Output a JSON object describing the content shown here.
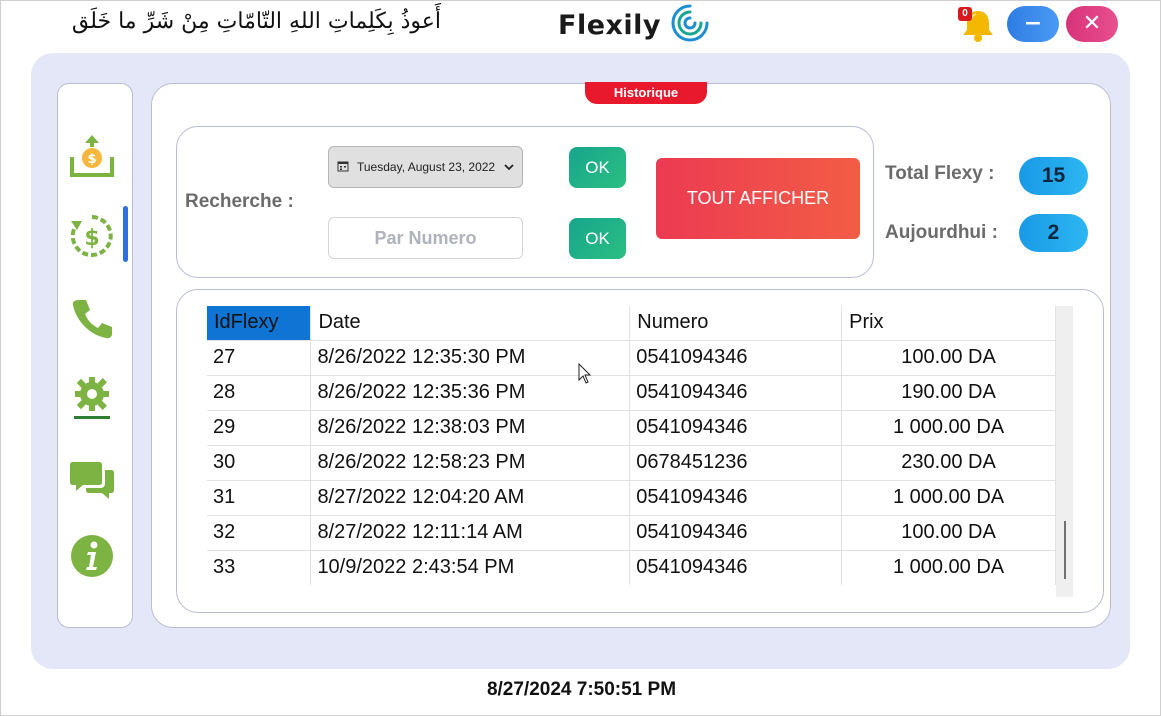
{
  "header": {
    "arabic_text": "أَعوذُ بِكَلِماتِ اللهِ التّامّاتِ مِنْ شَرِّ ما خَلَق",
    "brand_name": "Flexily",
    "brand_icon": "spiral-logo",
    "notification_count": "0",
    "minimize_label": "−",
    "close_label": "✕"
  },
  "sidebar": {
    "items": [
      {
        "name": "upload-money-icon"
      },
      {
        "name": "history-money-icon"
      },
      {
        "name": "phone-icon"
      },
      {
        "name": "settings-icon"
      },
      {
        "name": "chat-icon"
      },
      {
        "name": "info-icon"
      }
    ],
    "accent_color": "#7cb342",
    "active_index": 1
  },
  "tab": {
    "title": "Historique"
  },
  "search": {
    "label": "Recherche :",
    "date_value": "Tuesday, August 23, 2022",
    "number_placeholder": "Par Numero",
    "ok_label_1": "OK",
    "ok_label_2": "OK",
    "show_all_label": "TOUT AFFICHER"
  },
  "stats": {
    "total_label": "Total Flexy  :",
    "total_value": "15",
    "today_label": "Aujourdhui :",
    "today_value": "2"
  },
  "table": {
    "columns": [
      "IdFlexy",
      "Date",
      "Numero",
      "Prix"
    ],
    "rows": [
      [
        "27",
        "8/26/2022 12:35:30 PM",
        "0541094346",
        "100.00 DA"
      ],
      [
        "28",
        "8/26/2022 12:35:36 PM",
        "0541094346",
        "190.00 DA"
      ],
      [
        "29",
        "8/26/2022 12:38:03 PM",
        "0541094346",
        "1 000.00 DA"
      ],
      [
        "30",
        "8/26/2022 12:58:23 PM",
        "0678451236",
        "230.00 DA"
      ],
      [
        "31",
        "8/27/2022 12:04:20 AM",
        "0541094346",
        "1 000.00 DA"
      ],
      [
        "32",
        "8/27/2022 12:11:14 AM",
        "0541094346",
        "100.00 DA"
      ],
      [
        "33",
        "10/9/2022 2:43:54 PM",
        "0541094346",
        "1 000.00 DA"
      ]
    ]
  },
  "footer": {
    "datetime": "8/27/2024 7:50:51 PM"
  },
  "colors": {
    "tab_red": "#e8192c",
    "ok_green": "#17a58c",
    "show_all": "#ec3a52",
    "pill_blue": "#1a9ae6",
    "selected_header": "#0f74d3"
  }
}
